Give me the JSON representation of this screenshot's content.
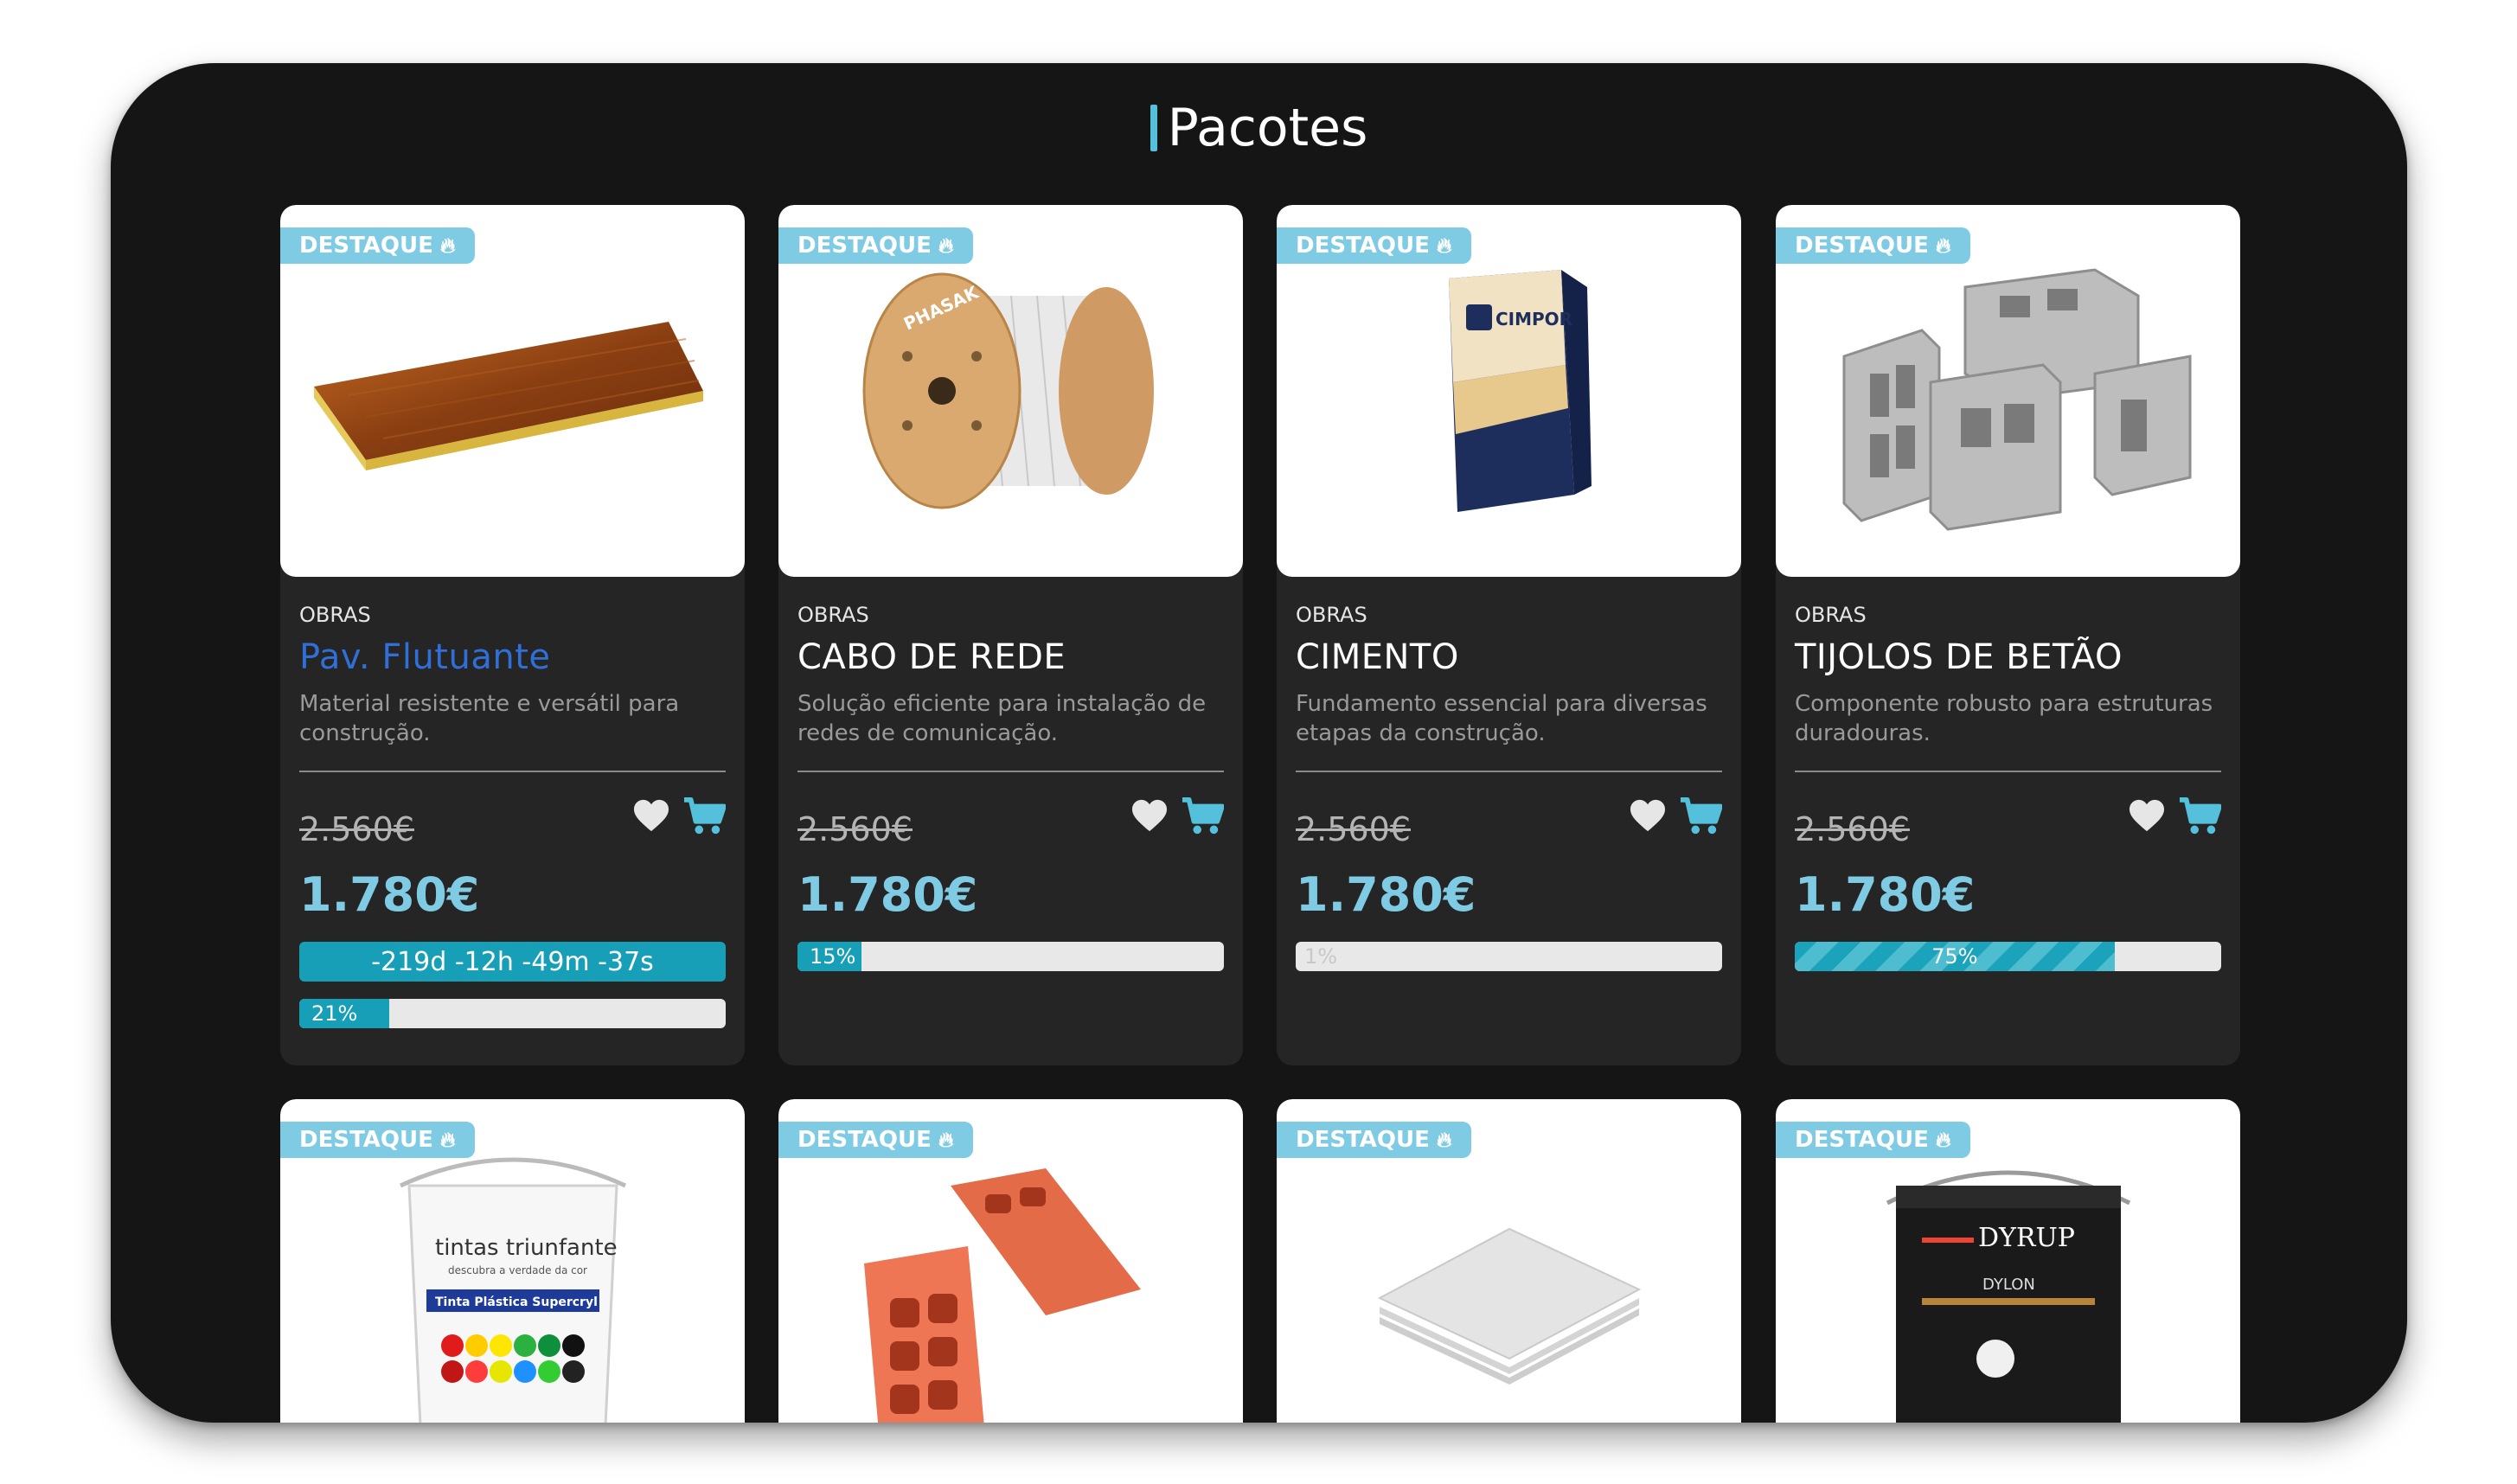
{
  "page": {
    "title": "Pacotes",
    "accent_color": "#55c0dc",
    "badge_color": "#7fcbe4",
    "price_color": "#7fcbe4"
  },
  "products_row1": [
    {
      "badge": "DESTAQUE",
      "category": "OBRAS",
      "name": "Pav. Flutuante",
      "description": "Material resistente e versátil para construção.",
      "old_price": "2.560€",
      "price": "1.780€",
      "timer": "-219d -12h -49m -37s",
      "progress": 0.21,
      "progress_label": "21%",
      "image_icon": "wood-floor-panel-icon"
    },
    {
      "badge": "DESTAQUE",
      "category": "OBRAS",
      "name": "CABO DE REDE",
      "description": "Solução eficiente para instalação de redes de comunicação.",
      "old_price": "2.560€",
      "price": "1.780€",
      "progress": 0.15,
      "progress_label": "15%",
      "image_icon": "cable-spool-icon",
      "image_brand": "PHASAK"
    },
    {
      "badge": "DESTAQUE",
      "category": "OBRAS",
      "name": "CIMENTO",
      "description": "Fundamento essencial para diversas etapas da construção.",
      "old_price": "2.560€",
      "price": "1.780€",
      "progress": 0.01,
      "progress_label": "1%",
      "image_icon": "cement-bag-icon",
      "image_brand": "CIMPOR"
    },
    {
      "badge": "DESTAQUE",
      "category": "OBRAS",
      "name": "TIJOLOS DE BETÃO",
      "description": "Componente robusto para estruturas duradouras.",
      "old_price": "2.560€",
      "price": "1.780€",
      "progress": 0.75,
      "progress_label": "75%",
      "image_icon": "concrete-blocks-icon"
    }
  ],
  "products_row2": [
    {
      "badge": "DESTAQUE",
      "image_icon": "paint-bucket-icon",
      "image_brand": "tintas triunfante",
      "image_tagline": "descubra a verdade da cor",
      "image_label": "Tinta Plástica Supercryl"
    },
    {
      "badge": "DESTAQUE",
      "image_icon": "clay-bricks-icon"
    },
    {
      "badge": "DESTAQUE",
      "image_icon": "plaster-boards-icon"
    },
    {
      "badge": "DESTAQUE",
      "image_icon": "paint-can-icon",
      "image_brand": "DYRUP",
      "image_label": "DYLON"
    }
  ]
}
